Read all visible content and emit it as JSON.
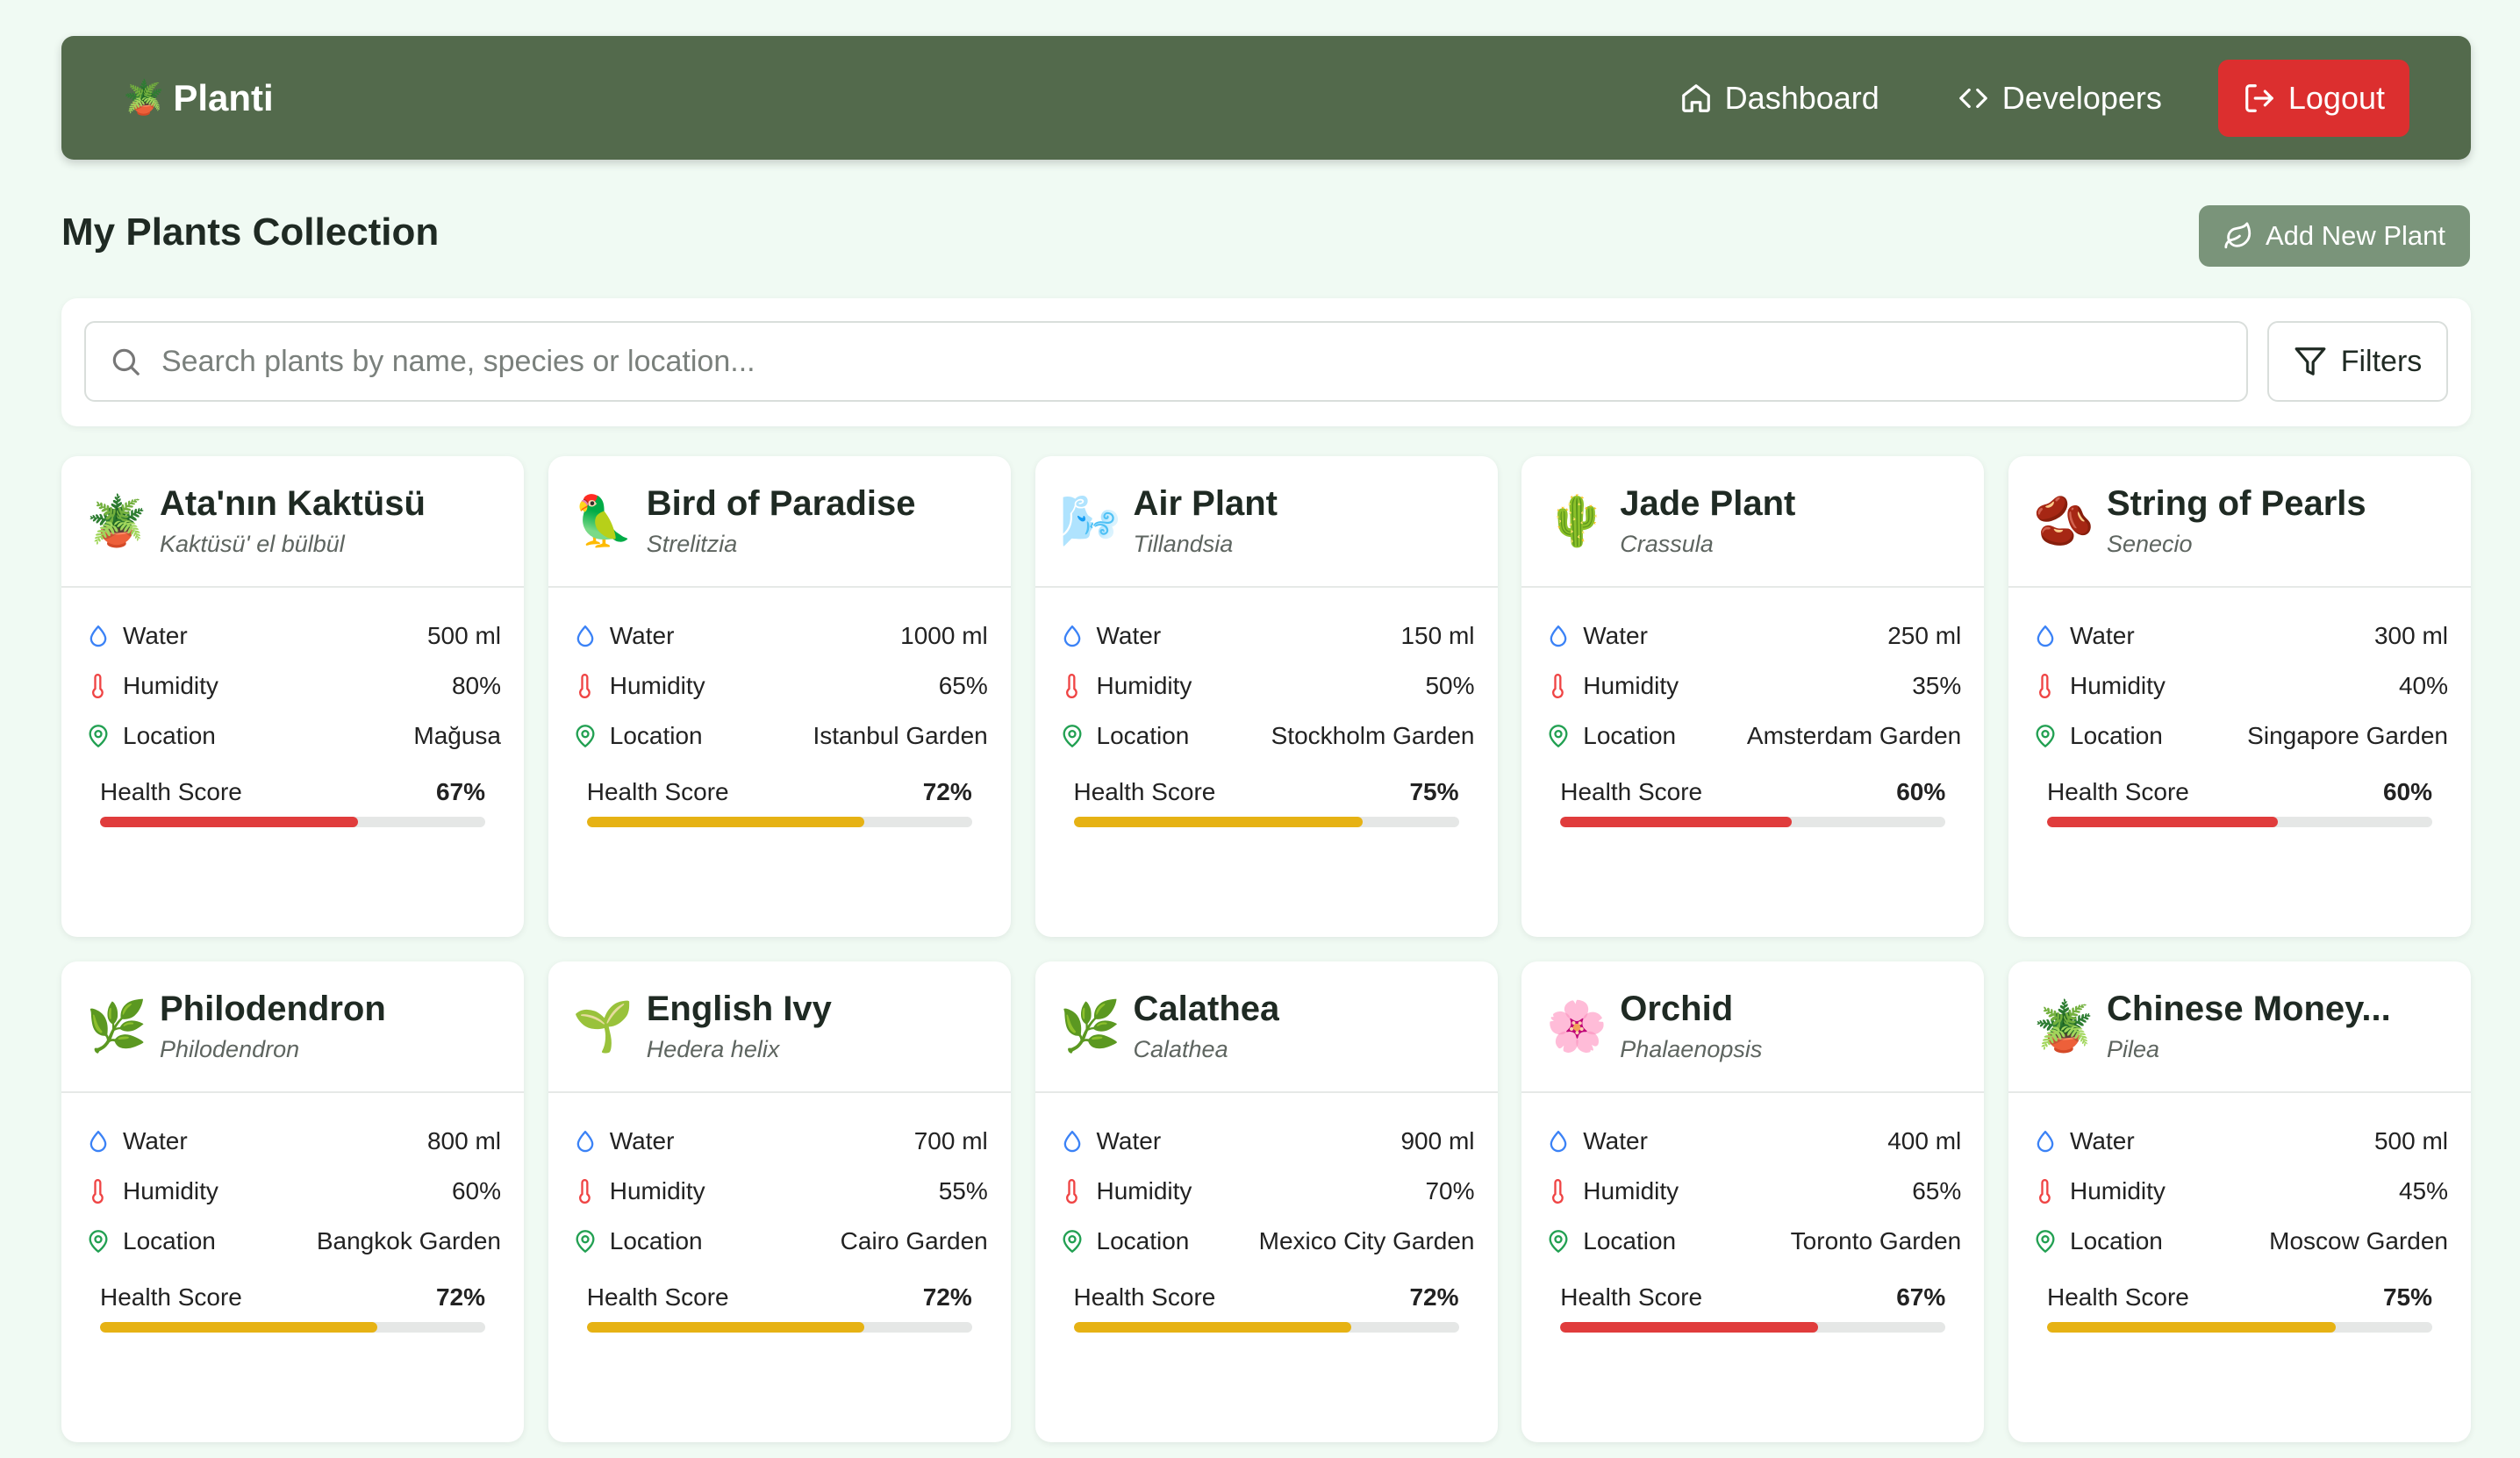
{
  "nav": {
    "brand_emoji": "🪴",
    "brand": "Planti",
    "dashboard": "Dashboard",
    "developers": "Developers",
    "logout": "Logout"
  },
  "page": {
    "title": "My Plants Collection",
    "add_button": "Add New Plant"
  },
  "search": {
    "placeholder": "Search plants by name, species or location...",
    "filters": "Filters"
  },
  "labels": {
    "water": "Water",
    "humidity": "Humidity",
    "location": "Location",
    "health": "Health Score"
  },
  "colors": {
    "navbar": "#536a4c",
    "logout": "#dc2f2f",
    "add_button": "#7a947a",
    "health_low": "#e03c3c",
    "health_mid": "#e6b214",
    "water_icon": "#3b82f6",
    "humidity_icon": "#ef4444",
    "location_icon": "#22a052"
  },
  "plants": [
    {
      "emoji": "🪴",
      "name": "Ata'nın Kaktüsü",
      "species": "Kaktüsü' el bülbül",
      "water": "500 ml",
      "humidity": "80%",
      "location": "Mağusa",
      "health": "67%",
      "health_value": 0.67,
      "health_color": "#e03c3c"
    },
    {
      "emoji": "🦜",
      "name": "Bird of Paradise",
      "species": "Strelitzia",
      "water": "1000 ml",
      "humidity": "65%",
      "location": "Istanbul Garden",
      "health": "72%",
      "health_value": 0.72,
      "health_color": "#e6b214"
    },
    {
      "emoji": "🌬️",
      "name": "Air Plant",
      "species": "Tillandsia",
      "water": "150 ml",
      "humidity": "50%",
      "location": "Stockholm Garden",
      "health": "75%",
      "health_value": 0.75,
      "health_color": "#e6b214"
    },
    {
      "emoji": "🌵",
      "name": "Jade Plant",
      "species": "Crassula",
      "water": "250 ml",
      "humidity": "35%",
      "location": "Amsterdam Garden",
      "health": "60%",
      "health_value": 0.6,
      "health_color": "#e03c3c"
    },
    {
      "emoji": "🫘",
      "name": "String of Pearls",
      "species": "Senecio",
      "water": "300 ml",
      "humidity": "40%",
      "location": "Singapore Garden",
      "health": "60%",
      "health_value": 0.6,
      "health_color": "#e03c3c"
    },
    {
      "emoji": "🌿",
      "name": "Philodendron",
      "species": "Philodendron",
      "water": "800 ml",
      "humidity": "60%",
      "location": "Bangkok Garden",
      "health": "72%",
      "health_value": 0.72,
      "health_color": "#e6b214"
    },
    {
      "emoji": "🌱",
      "name": "English Ivy",
      "species": "Hedera helix",
      "water": "700 ml",
      "humidity": "55%",
      "location": "Cairo Garden",
      "health": "72%",
      "health_value": 0.72,
      "health_color": "#e6b214"
    },
    {
      "emoji": "🌿",
      "name": "Calathea",
      "species": "Calathea",
      "water": "900 ml",
      "humidity": "70%",
      "location": "Mexico City Garden",
      "health": "72%",
      "health_value": 0.72,
      "health_color": "#e6b214"
    },
    {
      "emoji": "🌸",
      "name": "Orchid",
      "species": "Phalaenopsis",
      "water": "400 ml",
      "humidity": "65%",
      "location": "Toronto Garden",
      "health": "67%",
      "health_value": 0.67,
      "health_color": "#e03c3c"
    },
    {
      "emoji": "🪴",
      "name": "Chinese Money...",
      "species": "Pilea",
      "water": "500 ml",
      "humidity": "45%",
      "location": "Moscow Garden",
      "health": "75%",
      "health_value": 0.75,
      "health_color": "#e6b214"
    }
  ]
}
